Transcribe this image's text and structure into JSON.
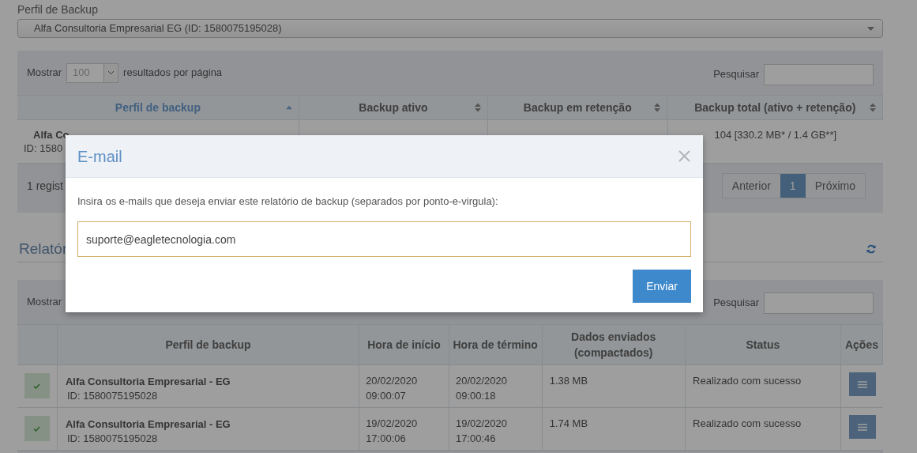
{
  "profile_field": {
    "label": "Perfil de Backup",
    "value": "Alfa Consultoria Empresarial EG (ID: 1580075195028)"
  },
  "summary_panel": {
    "length_menu": {
      "prefix": "Mostrar",
      "value": "100",
      "suffix": "resultados por página"
    },
    "search_label": "Pesquisar",
    "table": {
      "columns": [
        {
          "label": "Perfil de backup",
          "sorted": true
        },
        {
          "label": "Backup ativo",
          "sorted": false
        },
        {
          "label": "Backup em retenção",
          "sorted": false
        },
        {
          "label": "Backup total (ativo + retenção)",
          "sorted": false
        }
      ],
      "rows": [
        {
          "profile": "Alfa Co",
          "id": "ID: 1580",
          "total": "104 [330.2 MB* / 1.4 GB**]"
        }
      ]
    },
    "info": "1 regist",
    "pagination": [
      {
        "label": "Anterior",
        "selected": false
      },
      {
        "label": "1",
        "selected": true
      },
      {
        "label": "Próximo",
        "selected": false
      }
    ]
  },
  "reports_panel": {
    "title": "Relatór",
    "length_prefix": "Mostrar",
    "search_label": "Pesquisar",
    "table": {
      "columns": [
        {
          "label": "Perfil de backup"
        },
        {
          "label": "Hora de início"
        },
        {
          "label": "Hora de término"
        },
        {
          "label": "Dados enviados (compactados)"
        },
        {
          "label": "Status"
        },
        {
          "label": "Ações"
        }
      ],
      "rows": [
        {
          "success": true,
          "profile": "Alfa Consultoria Empresarial - EG",
          "id": "ID: 1580075195028",
          "start": [
            "20/02/2020",
            "09:00:07"
          ],
          "end": [
            "20/02/2020",
            "09:00:18"
          ],
          "data": "1.38 MB",
          "status": "Realizado com sucesso"
        },
        {
          "success": true,
          "profile": "Alfa Consultoria Empresarial - EG",
          "id": "ID: 1580075195028",
          "start": [
            "19/02/2020",
            "17:00:06"
          ],
          "end": [
            "19/02/2020",
            "17:00:46"
          ],
          "data": "1.74 MB",
          "status": "Realizado com sucesso"
        }
      ]
    }
  },
  "modal": {
    "title": "E-mail",
    "prompt": "Insira os e-mails que deseja enviar este relatório de backup (separados por ponto-e-virgula):",
    "email_value": "suporte@eagletecnologia.com",
    "submit": "Enviar"
  }
}
